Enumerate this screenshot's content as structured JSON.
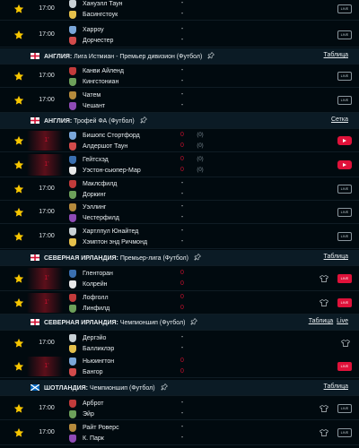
{
  "colors": {
    "background": "#010a0f",
    "header_bg": "#0b1b25",
    "star": "#f7c600",
    "live": "#c8102e",
    "live_button": "#e0123a"
  },
  "icons": {
    "favorite": "star-icon",
    "pin": "pin-icon",
    "tv": "tv-live-icon",
    "play": "play-icon",
    "shirt": "lineup-shirt-icon"
  },
  "rows": [
    {
      "kind": "match",
      "time": "17:00",
      "home": "Хануэлл Таун",
      "away": "Басингстоук",
      "home_score": "-",
      "away_score": "-",
      "tv": "LIVE"
    },
    {
      "kind": "match",
      "time": "17:00",
      "home": "Харроу",
      "away": "Дорчестер",
      "home_score": "-",
      "away_score": "-",
      "tv": "LIVE"
    },
    {
      "kind": "header",
      "country": "АНГЛИЯ:",
      "league": "Лига Истмиан - Премьер дивизион (Футбол)",
      "links": [
        "Таблица"
      ]
    },
    {
      "kind": "match",
      "time": "17:00",
      "home": "Канви Айленд",
      "away": "Кингстониан",
      "home_score": "-",
      "away_score": "-",
      "tv": "LIVE"
    },
    {
      "kind": "match",
      "time": "17:00",
      "home": "Чатем",
      "away": "Чешант",
      "home_score": "-",
      "away_score": "-",
      "tv": "LIVE"
    },
    {
      "kind": "header",
      "country": "АНГЛИЯ:",
      "league": "Трофей ФА (Футбол)",
      "links": [
        "Сетка"
      ]
    },
    {
      "kind": "match",
      "live": true,
      "minute": "1'",
      "home": "Бишопс Стортфорд",
      "away": "Алдершот Таун",
      "home_score": "0",
      "away_score": "0",
      "home_ht": "(0)",
      "away_ht": "(0)",
      "tv": "play"
    },
    {
      "kind": "match",
      "live": true,
      "minute": "1'",
      "home": "Гейтсхэд",
      "away": "Уэстон-сьюпер-Мар",
      "home_score": "0",
      "away_score": "0",
      "home_ht": "(0)",
      "away_ht": "(0)",
      "tv": "play"
    },
    {
      "kind": "match",
      "time": "17:00",
      "home": "Маклсфилд",
      "away": "Доркинг",
      "home_score": "-",
      "away_score": "-",
      "tv": "LIVE"
    },
    {
      "kind": "match",
      "time": "17:00",
      "home": "Уэллинг",
      "away": "Честерфилд",
      "home_score": "-",
      "away_score": "-",
      "tv": "LIVE"
    },
    {
      "kind": "match",
      "time": "17:00",
      "home": "Хартлпул Юнайтед",
      "away": "Хэмптон энд Ричмонд",
      "home_score": "-",
      "away_score": "-",
      "tv": "LIVE"
    },
    {
      "kind": "header",
      "country": "СЕВЕРНАЯ ИРЛАНДИЯ:",
      "league": "Премьер-лига (Футбол)",
      "links": [
        "Таблица"
      ]
    },
    {
      "kind": "match",
      "live": true,
      "minute": "1'",
      "home": "Гленторан",
      "away": "Колрейн",
      "home_score": "0",
      "away_score": "0",
      "tv": "LIVE",
      "tv_red": true,
      "shirt": true
    },
    {
      "kind": "match",
      "live": true,
      "minute": "1'",
      "home": "Лофголл",
      "away": "Линфилд",
      "home_score": "0",
      "away_score": "0",
      "tv": "LIVE",
      "tv_red": true,
      "shirt": true
    },
    {
      "kind": "header",
      "country": "СЕВЕРНАЯ ИРЛАНДИЯ:",
      "league": "Чемпионшип (Футбол)",
      "links": [
        "Таблица",
        "Live"
      ]
    },
    {
      "kind": "match",
      "time": "17:00",
      "home": "Дергэйо",
      "away": "Балликлэр",
      "home_score": "-",
      "away_score": "-",
      "shirt": true
    },
    {
      "kind": "match",
      "live": true,
      "minute": "1'",
      "home": "Ньюингтон",
      "away": "Бангор",
      "home_score": "0",
      "away_score": "0",
      "tv": "LIVE",
      "tv_red": true
    },
    {
      "kind": "header",
      "country": "ШОТЛАНДИЯ:",
      "league": "Чемпионшип (Футбол)",
      "links": [
        "Таблица"
      ]
    },
    {
      "kind": "match",
      "time": "17:00",
      "home": "Арброт",
      "away": "Эйр",
      "home_score": "-",
      "away_score": "-",
      "tv": "LIVE",
      "shirt": true
    },
    {
      "kind": "match",
      "time": "17:00",
      "home": "Райт Роверс",
      "away": "К. Парк",
      "home_score": "-",
      "away_score": "-",
      "tv": "LIVE",
      "shirt": true
    }
  ]
}
